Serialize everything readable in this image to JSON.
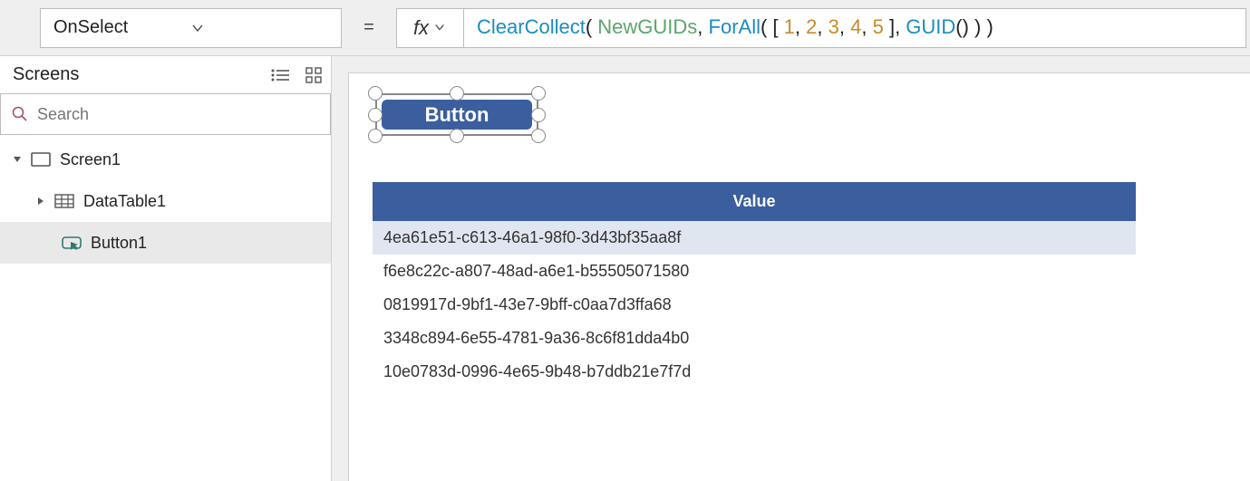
{
  "property_selector": {
    "value": "OnSelect"
  },
  "formula_bar": {
    "fx_label": "fx",
    "tokens": [
      {
        "t": "fn",
        "v": "ClearCollect"
      },
      {
        "t": "pun",
        "v": "( "
      },
      {
        "t": "var",
        "v": "NewGUIDs"
      },
      {
        "t": "pun",
        "v": ", "
      },
      {
        "t": "fn",
        "v": "ForAll"
      },
      {
        "t": "pun",
        "v": "( [ "
      },
      {
        "t": "num",
        "v": "1"
      },
      {
        "t": "pun",
        "v": ", "
      },
      {
        "t": "num",
        "v": "2"
      },
      {
        "t": "pun",
        "v": ", "
      },
      {
        "t": "num",
        "v": "3"
      },
      {
        "t": "pun",
        "v": ", "
      },
      {
        "t": "num",
        "v": "4"
      },
      {
        "t": "pun",
        "v": ", "
      },
      {
        "t": "num",
        "v": "5"
      },
      {
        "t": "pun",
        "v": " ], "
      },
      {
        "t": "fn",
        "v": "GUID"
      },
      {
        "t": "pun",
        "v": "() ) )"
      }
    ]
  },
  "screens_panel": {
    "title": "Screens",
    "search_placeholder": "Search",
    "tree": {
      "screen": "Screen1",
      "datatable": "DataTable1",
      "button": "Button1"
    }
  },
  "canvas": {
    "button_label": "Button",
    "table_header": "Value",
    "rows": [
      "4ea61e51-c613-46a1-98f0-3d43bf35aa8f",
      "f6e8c22c-a807-48ad-a6e1-b55505071580",
      "0819917d-9bf1-43e7-9bff-c0aa7d3ffa68",
      "3348c894-6e55-4781-9a36-8c6f81dda4b0",
      "10e0783d-0996-4e65-9b48-b7ddb21e7f7d"
    ]
  },
  "colors": {
    "accent": "#3a5e9e"
  }
}
